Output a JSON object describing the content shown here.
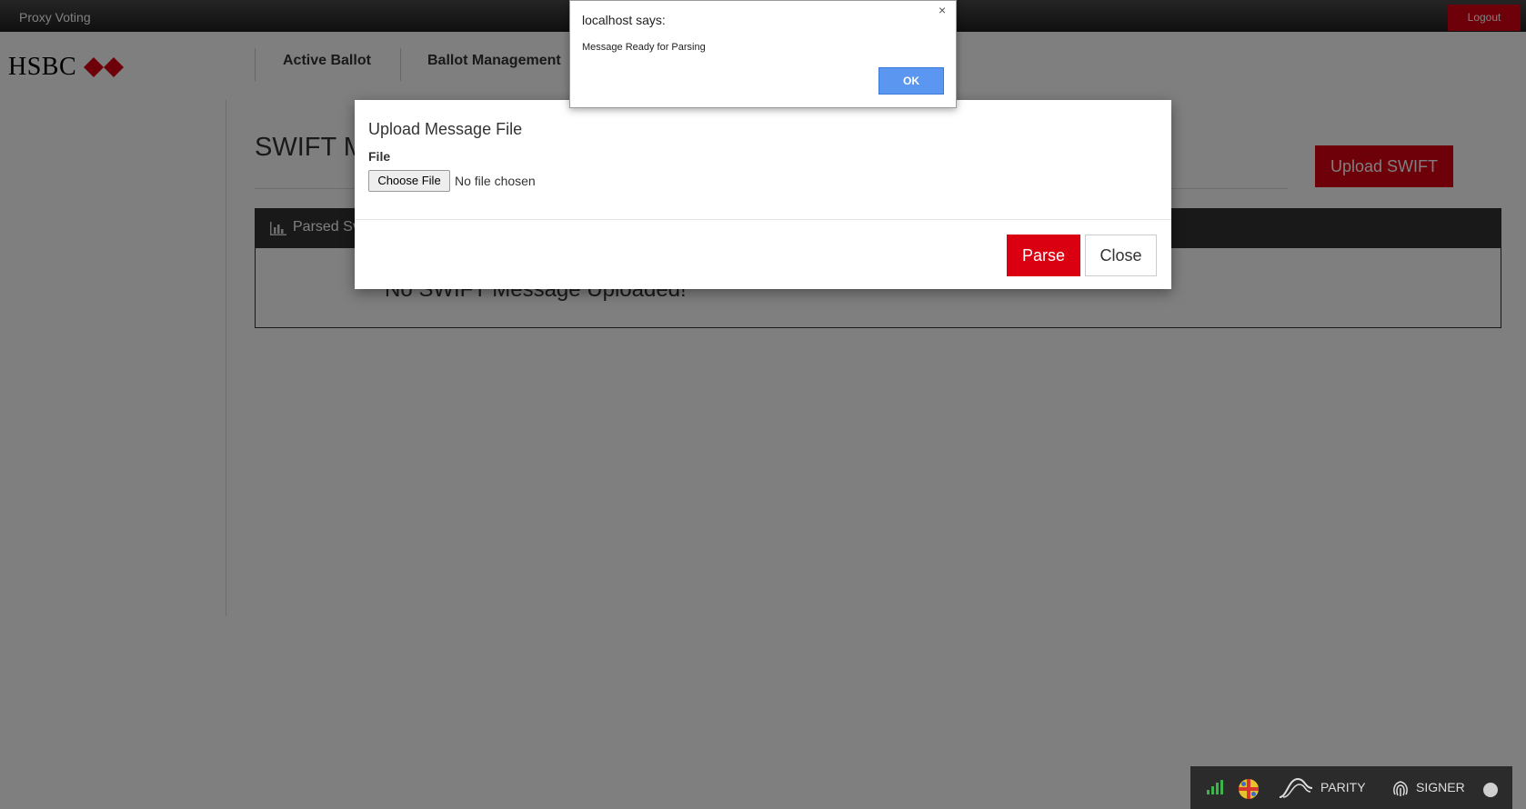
{
  "header": {
    "app_title": "Proxy Voting",
    "logout_label": "Logout"
  },
  "brand": {
    "logo_text": "HSBC",
    "colors": {
      "brand_red": "#db0011",
      "alert_blue": "#5b97f0"
    }
  },
  "nav": {
    "items": [
      {
        "label": "Active Ballot"
      },
      {
        "label": "Ballot Management"
      }
    ]
  },
  "page": {
    "title": "SWIFT M",
    "upload_button_label": "Upload SWIFT"
  },
  "panel": {
    "title": "Parsed Sv",
    "empty_message": "No SWIFT Message Uploaded!"
  },
  "modal": {
    "title": "Upload Message File",
    "file_label": "File",
    "choose_file_label": "Choose File",
    "no_file_text": "No file chosen",
    "parse_label": "Parse",
    "close_label": "Close"
  },
  "alert": {
    "title": "localhost says:",
    "message": "Message Ready for Parsing",
    "ok_label": "OK",
    "close_glyph": "×"
  },
  "extension_bar": {
    "parity_label": "PARITY",
    "signer_label": "SIGNER",
    "icons": [
      "signal-icon",
      "metamask-icon",
      "parity-wave-icon",
      "fingerprint-icon",
      "status-dot-icon"
    ]
  }
}
